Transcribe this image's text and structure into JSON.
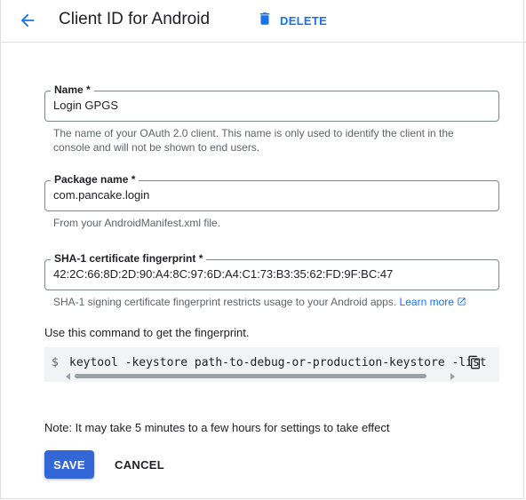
{
  "header": {
    "title": "Client ID for Android",
    "delete_label": "DELETE",
    "back_icon": "arrow-back-icon",
    "delete_icon": "trash-icon"
  },
  "fields": {
    "name": {
      "label": "Name *",
      "value": "Login GPGS",
      "help": "The name of your OAuth 2.0 client. This name is only used to identify the client in the",
      "help2": "console and will not be shown to end users."
    },
    "package": {
      "label": "Package name *",
      "value": "com.pancake.login",
      "help": "From your AndroidManifest.xml file."
    },
    "sha1": {
      "label": "SHA-1 certificate fingerprint *",
      "value": "42:2C:66:8D:2D:90:A4:8C:97:6D:A4:C1:73:B3:35:62:FD:9F:BC:47",
      "help": "SHA-1 signing certificate fingerprint restricts usage to your Android apps.",
      "learn_more": "Learn more"
    }
  },
  "command": {
    "intro": "Use this command to get the fingerprint.",
    "prompt": "$",
    "text": "keytool -keystore path-to-debug-or-production-keystore -list",
    "copy_icon": "copy-icon"
  },
  "note": "Note: It may take 5 minutes to a few hours for settings to take effect",
  "actions": {
    "save": "SAVE",
    "cancel": "CANCEL"
  },
  "colors": {
    "accent": "#1a73e8",
    "primary_button": "#3367d6"
  }
}
